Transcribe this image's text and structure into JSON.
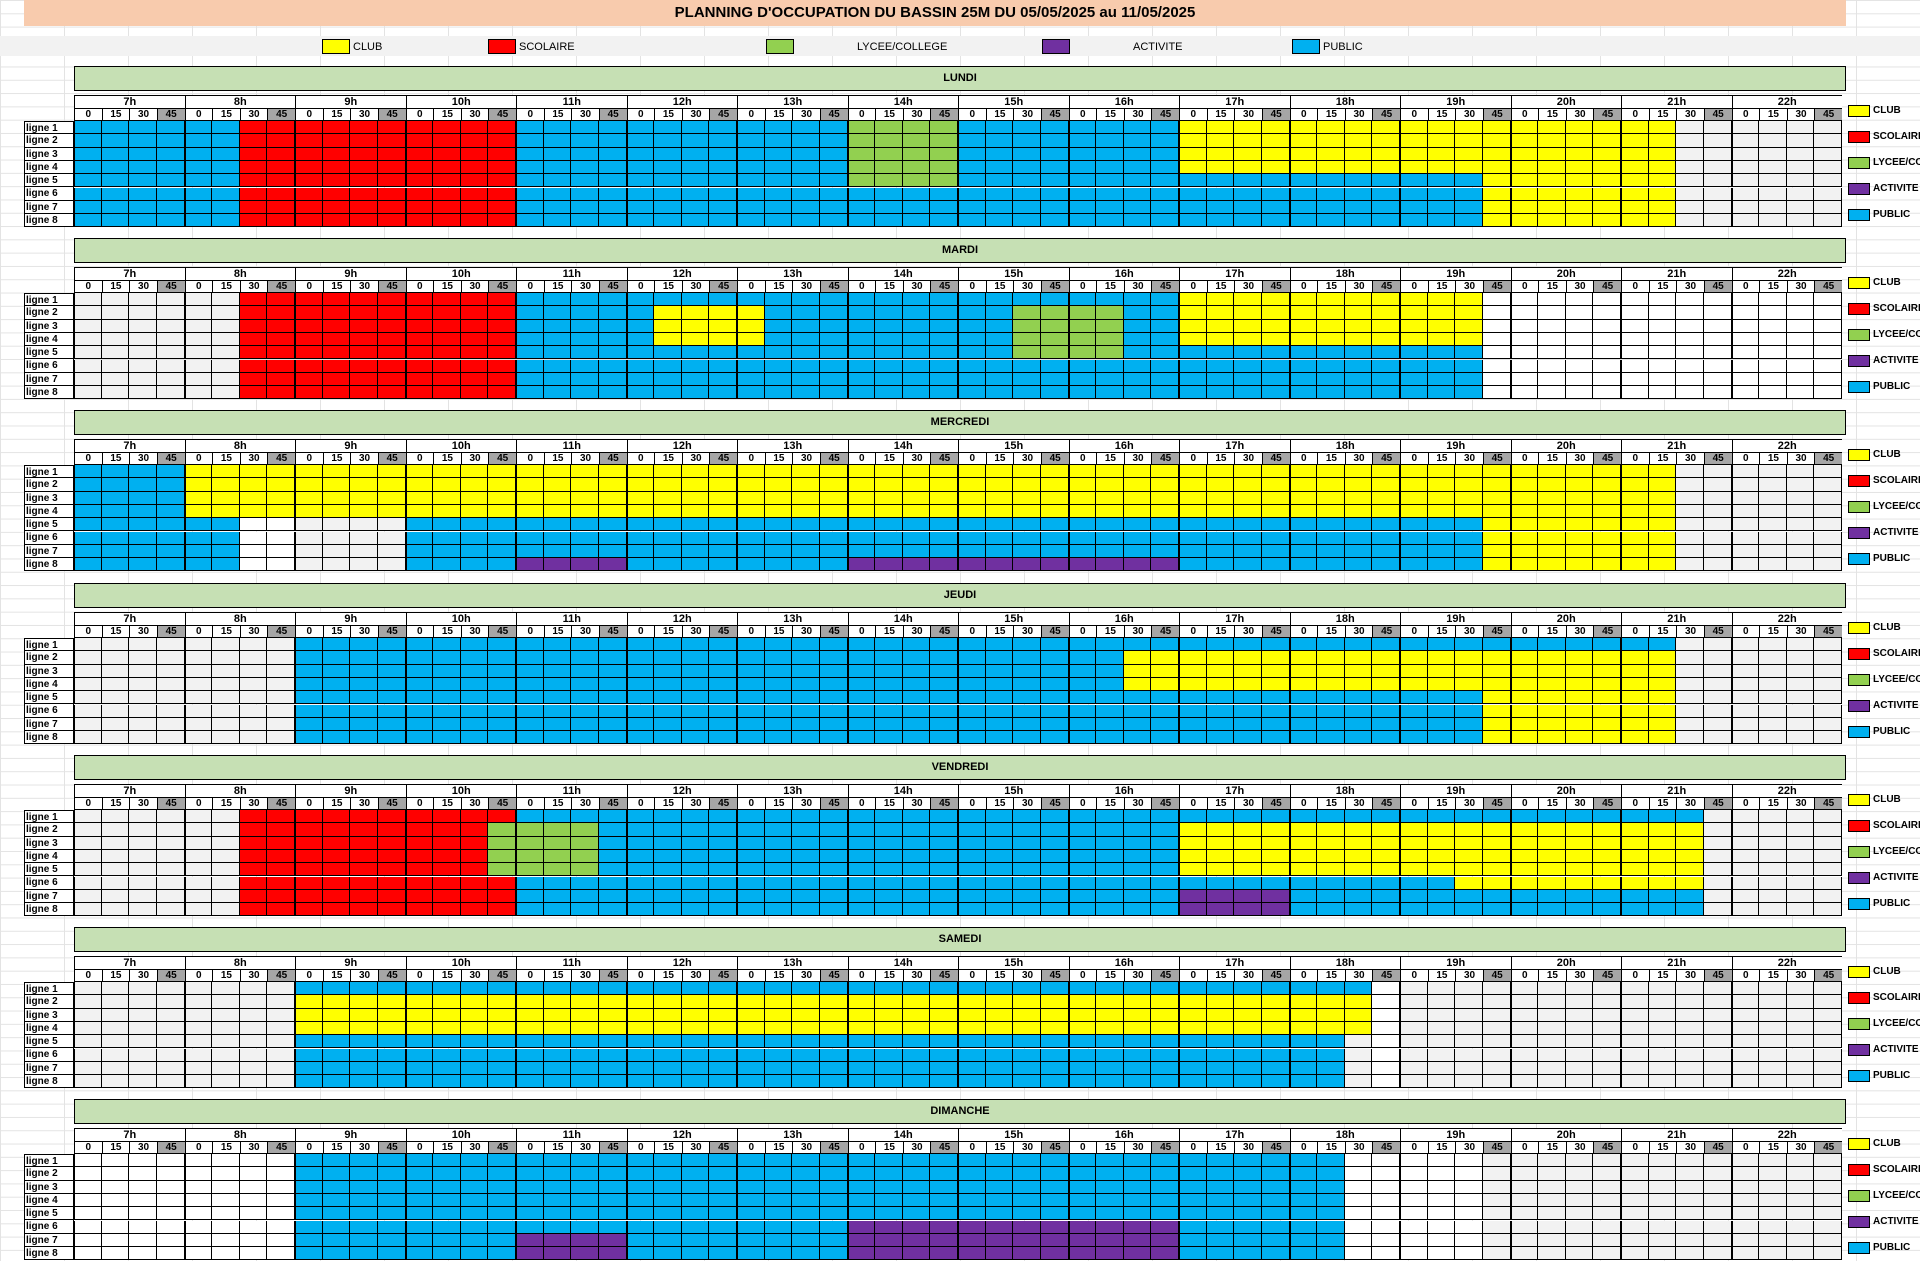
{
  "title": "PLANNING D'OCCUPATION DU BASSIN 25M DU 05/05/2025 au 11/05/2025",
  "colors": {
    "CLUB": "#ffff00",
    "SCOLAIRE": "#ff0000",
    "LYCEE": "#92d050",
    "ACTIVITE": "#7030a0",
    "PUBLIC": "#00b0f0",
    "CLOSED": "#f2f2f2",
    "EMPTY": "#ffffff"
  },
  "legend": [
    {
      "key": "CLUB",
      "label": "CLUB"
    },
    {
      "key": "SCOLAIRE",
      "label": "SCOLAIRE"
    },
    {
      "key": "LYCEE",
      "label": "LYCEE/COLLEGE"
    },
    {
      "key": "ACTIVITE",
      "label": "ACTIVITE"
    },
    {
      "key": "PUBLIC",
      "label": "PUBLIC"
    }
  ],
  "side_legend": [
    {
      "key": "CLUB",
      "label": "CLUB"
    },
    {
      "key": "SCOLAIRE",
      "label": "SCOLAIRE"
    },
    {
      "key": "LYCEE",
      "label": "LYCEE/CO"
    },
    {
      "key": "ACTIVITE",
      "label": "ACTIVITE"
    },
    {
      "key": "PUBLIC",
      "label": "PUBLIC"
    }
  ],
  "hours": [
    "7h",
    "8h",
    "9h",
    "10h",
    "11h",
    "12h",
    "13h",
    "14h",
    "15h",
    "16h",
    "17h",
    "18h",
    "19h",
    "20h",
    "21h",
    "22h"
  ],
  "minutes": [
    "0",
    "15",
    "30",
    "45"
  ],
  "lines": [
    "ligne 1",
    "ligne 2",
    "ligne 3",
    "ligne 4",
    "ligne 5",
    "ligne 6",
    "ligne 7",
    "ligne 8"
  ],
  "days": [
    {
      "name": "LUNDI",
      "base": "CLOSED",
      "blocks": [
        {
          "lines": [
            1,
            8
          ],
          "from": "7:00",
          "to": "8:30",
          "type": "PUBLIC"
        },
        {
          "lines": [
            1,
            8
          ],
          "from": "8:30",
          "to": "11:00",
          "type": "SCOLAIRE"
        },
        {
          "lines": [
            1,
            8
          ],
          "from": "11:00",
          "to": "14:00",
          "type": "PUBLIC"
        },
        {
          "lines": [
            1,
            5
          ],
          "from": "14:00",
          "to": "15:00",
          "type": "LYCEE"
        },
        {
          "lines": [
            6,
            8
          ],
          "from": "14:00",
          "to": "15:00",
          "type": "PUBLIC"
        },
        {
          "lines": [
            1,
            8
          ],
          "from": "15:00",
          "to": "17:00",
          "type": "PUBLIC"
        },
        {
          "lines": [
            1,
            4
          ],
          "from": "17:00",
          "to": "21:30",
          "type": "CLUB"
        },
        {
          "lines": [
            5,
            8
          ],
          "from": "17:00",
          "to": "19:45",
          "type": "PUBLIC"
        },
        {
          "lines": [
            5,
            8
          ],
          "from": "19:45",
          "to": "21:30",
          "type": "CLUB"
        }
      ]
    },
    {
      "name": "MARDI",
      "base": "CLOSED",
      "blocks": [
        {
          "lines": [
            1,
            8
          ],
          "from": "8:30",
          "to": "11:00",
          "type": "SCOLAIRE"
        },
        {
          "lines": [
            1,
            8
          ],
          "from": "11:00",
          "to": "12:15",
          "type": "PUBLIC"
        },
        {
          "lines": [
            2,
            4
          ],
          "from": "12:15",
          "to": "13:15",
          "type": "CLUB"
        },
        {
          "lines": [
            1,
            1
          ],
          "from": "12:15",
          "to": "13:15",
          "type": "PUBLIC"
        },
        {
          "lines": [
            5,
            8
          ],
          "from": "12:15",
          "to": "13:15",
          "type": "PUBLIC"
        },
        {
          "lines": [
            1,
            8
          ],
          "from": "13:15",
          "to": "15:30",
          "type": "PUBLIC"
        },
        {
          "lines": [
            2,
            5
          ],
          "from": "15:30",
          "to": "16:30",
          "type": "LYCEE"
        },
        {
          "lines": [
            1,
            1
          ],
          "from": "15:30",
          "to": "16:30",
          "type": "PUBLIC"
        },
        {
          "lines": [
            6,
            8
          ],
          "from": "15:30",
          "to": "16:30",
          "type": "PUBLIC"
        },
        {
          "lines": [
            1,
            8
          ],
          "from": "16:30",
          "to": "17:00",
          "type": "PUBLIC"
        },
        {
          "lines": [
            1,
            4
          ],
          "from": "17:00",
          "to": "19:45",
          "type": "CLUB"
        },
        {
          "lines": [
            5,
            8
          ],
          "from": "17:00",
          "to": "19:45",
          "type": "PUBLIC"
        },
        {
          "lines": [
            1,
            8
          ],
          "from": "19:45",
          "to": "23:00",
          "type": "EMPTY"
        }
      ]
    },
    {
      "name": "MERCREDI",
      "base": "CLOSED",
      "blocks": [
        {
          "lines": [
            1,
            8
          ],
          "from": "7:00",
          "to": "8:00",
          "type": "PUBLIC"
        },
        {
          "lines": [
            1,
            4
          ],
          "from": "8:00",
          "to": "21:30",
          "type": "CLUB"
        },
        {
          "lines": [
            5,
            8
          ],
          "from": "8:00",
          "to": "8:30",
          "type": "PUBLIC"
        },
        {
          "lines": [
            5,
            8
          ],
          "from": "8:30",
          "to": "9:00",
          "type": "EMPTY"
        },
        {
          "lines": [
            5,
            8
          ],
          "from": "10:00",
          "to": "19:45",
          "type": "PUBLIC"
        },
        {
          "lines": [
            8,
            8
          ],
          "from": "11:00",
          "to": "12:00",
          "type": "ACTIVITE"
        },
        {
          "lines": [
            8,
            8
          ],
          "from": "14:00",
          "to": "17:00",
          "type": "ACTIVITE"
        },
        {
          "lines": [
            5,
            8
          ],
          "from": "19:45",
          "to": "21:30",
          "type": "CLUB"
        }
      ]
    },
    {
      "name": "JEUDI",
      "base": "CLOSED",
      "blocks": [
        {
          "lines": [
            1,
            8
          ],
          "from": "9:00",
          "to": "16:30",
          "type": "PUBLIC"
        },
        {
          "lines": [
            1,
            1
          ],
          "from": "16:30",
          "to": "21:30",
          "type": "PUBLIC"
        },
        {
          "lines": [
            2,
            4
          ],
          "from": "16:30",
          "to": "21:30",
          "type": "CLUB"
        },
        {
          "lines": [
            5,
            8
          ],
          "from": "16:30",
          "to": "19:45",
          "type": "PUBLIC"
        },
        {
          "lines": [
            5,
            8
          ],
          "from": "19:45",
          "to": "21:30",
          "type": "CLUB"
        }
      ]
    },
    {
      "name": "VENDREDI",
      "base": "CLOSED",
      "blocks": [
        {
          "lines": [
            1,
            8
          ],
          "from": "8:30",
          "to": "10:45",
          "type": "SCOLAIRE"
        },
        {
          "lines": [
            1,
            8
          ],
          "from": "10:45",
          "to": "11:00",
          "type": "SCOLAIRE"
        },
        {
          "lines": [
            2,
            5
          ],
          "from": "10:45",
          "to": "11:45",
          "type": "LYCEE"
        },
        {
          "lines": [
            1,
            1
          ],
          "from": "11:00",
          "to": "11:45",
          "type": "PUBLIC"
        },
        {
          "lines": [
            6,
            8
          ],
          "from": "11:00",
          "to": "11:45",
          "type": "PUBLIC"
        },
        {
          "lines": [
            1,
            8
          ],
          "from": "11:45",
          "to": "17:00",
          "type": "PUBLIC"
        },
        {
          "lines": [
            1,
            5
          ],
          "from": "17:00",
          "to": "21:45",
          "type": "CLUB"
        },
        {
          "lines": [
            6,
            8
          ],
          "from": "17:00",
          "to": "19:30",
          "type": "PUBLIC"
        },
        {
          "lines": [
            6,
            6
          ],
          "from": "19:30",
          "to": "21:45",
          "type": "CLUB"
        },
        {
          "lines": [
            7,
            8
          ],
          "from": "19:30",
          "to": "21:45",
          "type": "PUBLIC"
        },
        {
          "lines": [
            7,
            8
          ],
          "from": "17:00",
          "to": "18:00",
          "type": "ACTIVITE"
        },
        {
          "lines": [
            1,
            1
          ],
          "from": "17:00",
          "to": "21:45",
          "type": "PUBLIC"
        }
      ]
    },
    {
      "name": "SAMEDI",
      "base": "CLOSED",
      "blocks": [
        {
          "lines": [
            1,
            4
          ],
          "from": "9:00",
          "to": "18:45",
          "type": "CLUB"
        },
        {
          "lines": [
            1,
            1
          ],
          "from": "9:00",
          "to": "18:45",
          "type": "PUBLIC"
        },
        {
          "lines": [
            5,
            8
          ],
          "from": "9:00",
          "to": "18:30",
          "type": "PUBLIC"
        },
        {
          "lines": [
            1,
            8
          ],
          "from": "18:45",
          "to": "19:00",
          "type": "EMPTY"
        }
      ]
    },
    {
      "name": "DIMANCHE",
      "base": "CLOSED",
      "blocks": [
        {
          "lines": [
            1,
            8
          ],
          "from": "7:00",
          "to": "9:00",
          "type": "EMPTY"
        },
        {
          "lines": [
            1,
            8
          ],
          "from": "9:00",
          "to": "18:30",
          "type": "PUBLIC"
        },
        {
          "lines": [
            7,
            8
          ],
          "from": "11:00",
          "to": "12:00",
          "type": "ACTIVITE"
        },
        {
          "lines": [
            6,
            8
          ],
          "from": "14:00",
          "to": "17:00",
          "type": "ACTIVITE"
        },
        {
          "lines": [
            1,
            8
          ],
          "from": "18:30",
          "to": "19:45",
          "type": "EMPTY"
        }
      ]
    }
  ]
}
